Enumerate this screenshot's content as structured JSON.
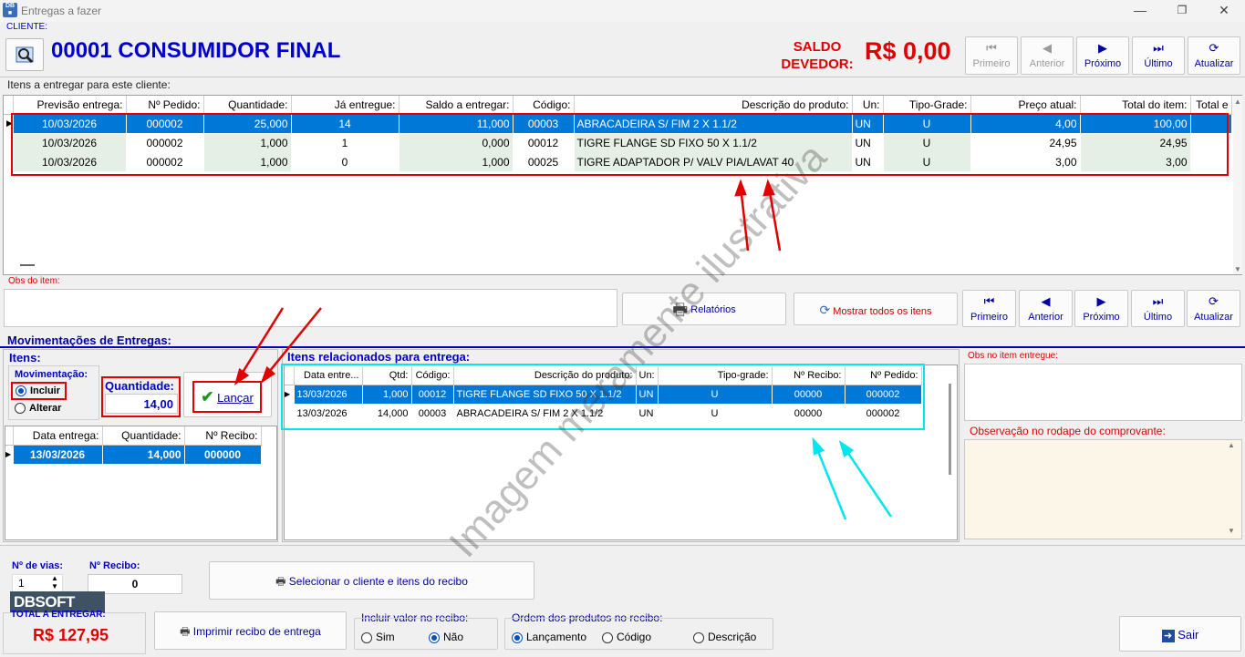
{
  "window": {
    "title": "Entregas a fazer",
    "minimize": "—",
    "maximize": "❐",
    "close": "✕"
  },
  "header": {
    "client_label": "CLIENTE:",
    "client_name": "00001 CONSUMIDOR FINAL",
    "saldo_label": "SALDO DEVEDOR:",
    "saldo_value": "R$ 0,00",
    "nav": [
      {
        "label": "Primeiro",
        "icon": "first-icon",
        "glyph": "⏮",
        "enabled": false
      },
      {
        "label": "Anterior",
        "icon": "prev-icon",
        "glyph": "◀",
        "enabled": false
      },
      {
        "label": "Próximo",
        "icon": "next-icon",
        "glyph": "▶",
        "enabled": true
      },
      {
        "label": "Último",
        "icon": "last-icon",
        "glyph": "⏭",
        "enabled": true
      },
      {
        "label": "Atualizar",
        "icon": "refresh-icon",
        "glyph": "⟳",
        "enabled": true
      }
    ]
  },
  "items_section": {
    "title": "Itens a entregar para este cliente:",
    "columns": [
      "Previsão entrega:",
      "Nº Pedido:",
      "Quantidade:",
      "Já entregue:",
      "Saldo a entregar:",
      "Código:",
      "Descrição do produto:",
      "Un:",
      "Tipo-Grade:",
      "Preço atual:",
      "Total do item:",
      "Total e"
    ],
    "rows": [
      [
        "10/03/2026",
        "000002",
        "25,000",
        "14",
        "11,000",
        "00003",
        "ABRACADEIRA S/ FIM 2 X 1.1/2",
        "UN",
        "U",
        "4,00",
        "100,00",
        ""
      ],
      [
        "10/03/2026",
        "000002",
        "1,000",
        "1",
        "0,000",
        "00012",
        "TIGRE FLANGE SD FIXO 50 X 1.1/2",
        "UN",
        "U",
        "24,95",
        "24,95",
        ""
      ],
      [
        "10/03/2026",
        "000002",
        "1,000",
        "0",
        "1,000",
        "00025",
        "TIGRE ADAPTADOR P/ VALV PIA/LAVAT 40",
        "UN",
        "U",
        "3,00",
        "3,00",
        ""
      ]
    ]
  },
  "obs_item_label": "Obs do item:",
  "mid_buttons": {
    "reports": "Relatórios",
    "show_all": "Mostrar todos os itens"
  },
  "nav2": [
    {
      "label": "Primeiro",
      "glyph": "⏮"
    },
    {
      "label": "Anterior",
      "glyph": "◀"
    },
    {
      "label": "Próximo",
      "glyph": "▶"
    },
    {
      "label": "Último",
      "glyph": "⏭"
    },
    {
      "label": "Atualizar",
      "glyph": "⟳"
    }
  ],
  "movements": {
    "title": "Movimentações de Entregas:",
    "itens_label": "Itens:",
    "mov_label": "Movimentação:",
    "include": "Incluir",
    "alter": "Alterar",
    "qty_label": "Quantidade:",
    "qty_value": "14,00",
    "launch": "Lançar",
    "columns": [
      "Data entrega:",
      "Quantidade:",
      "Nº Recibo:"
    ],
    "rows": [
      [
        "13/03/2026",
        "14,000",
        "000000"
      ]
    ]
  },
  "related": {
    "title": "Itens relacionados para entrega:",
    "columns": [
      "Data entre...",
      "Qtd:",
      "Código:",
      "Descrição do produto:",
      "Un:",
      "Tipo-grade:",
      "Nº Recibo:",
      "Nº Pedido:"
    ],
    "rows": [
      [
        "13/03/2026",
        "1,000",
        "00012",
        "TIGRE FLANGE SD FIXO 50 X 1.1/2",
        "UN",
        "U",
        "00000",
        "000002"
      ],
      [
        "13/03/2026",
        "14,000",
        "00003",
        "ABRACADEIRA S/ FIM 2 X 1.1/2",
        "UN",
        "U",
        "00000",
        "000002"
      ]
    ]
  },
  "right_panel": {
    "obs_delivered": "Obs no item entregue:",
    "footer_obs": "Observação no rodape do comprovante:"
  },
  "bottom": {
    "vias_label": "Nº de vias:",
    "vias_value": "1",
    "recibo_label": "Nº Recibo:",
    "recibo_value": "0",
    "select_btn": "Selecionar o cliente e itens do recibo",
    "total_label": "TOTAL A ENTREGAR:",
    "total_value": "R$ 127,95",
    "print_btn": "Imprimir recibo de entrega",
    "include_value_label": "Incluir valor no recibo:",
    "yes": "Sim",
    "no": "Não",
    "order_label": "Ordem dos produtos no recibo:",
    "order_launch": "Lançamento",
    "order_code": "Código",
    "order_desc": "Descrição",
    "exit": "Sair",
    "logo": "DBSOFT"
  },
  "watermark": "Imagem meramente ilustrativa",
  "colors": {
    "selection": "#0078d7",
    "red": "#e00000",
    "blue": "#0000c8",
    "cyan": "#00e5ee"
  }
}
